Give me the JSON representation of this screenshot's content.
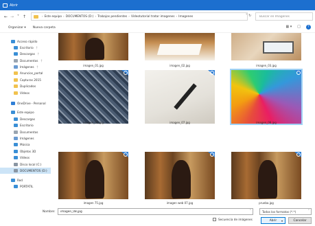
{
  "window": {
    "title": "Abrir"
  },
  "nav": {
    "back": "←",
    "forward": "→",
    "recent": "˅",
    "up": "↑"
  },
  "address": {
    "crumbs": [
      "Este equipo",
      "DOCUMENTOS (D:)",
      "Trabajos pendientes",
      "Videotutorial tratar imagenes",
      "Imagenes"
    ],
    "tools": "˅  ↻",
    "search_placeholder": "Buscar en Imagenes"
  },
  "toolbar": {
    "organize": "Organizar ▾",
    "new_folder": "Nueva carpeta",
    "view": "▦ ▾",
    "pane": "□",
    "help": "?"
  },
  "sidebar": {
    "items": [
      {
        "label": "Acceso rápido",
        "icon": "star-icon",
        "color": "#3a8fd6",
        "pinned": false
      },
      {
        "label": "Escritorio",
        "icon": "desktop-icon",
        "color": "#3a8fd6",
        "pinned": true
      },
      {
        "label": "Descargas",
        "icon": "download-icon",
        "color": "#3a8fd6",
        "pinned": true
      },
      {
        "label": "Documentos",
        "icon": "document-icon",
        "color": "#9aa5b1",
        "pinned": true
      },
      {
        "label": "Imágenes",
        "icon": "picture-icon",
        "color": "#6b9bd2",
        "pinned": true
      },
      {
        "label": "Anuncios_portal",
        "icon": "folder-icon",
        "color": "#f1c24e",
        "pinned": false
      },
      {
        "label": "Capturas 2015",
        "icon": "folder-icon",
        "color": "#f1c24e",
        "pinned": false
      },
      {
        "label": "Duplicados",
        "icon": "folder-icon",
        "color": "#f1c24e",
        "pinned": false
      },
      {
        "label": "Vídeos",
        "icon": "folder-icon",
        "color": "#f1c24e",
        "pinned": false
      },
      {
        "label": "OneDrive - Personal",
        "icon": "cloud-icon",
        "color": "#2f7fd6",
        "pinned": false
      },
      {
        "label": "Este equipo",
        "icon": "computer-icon",
        "color": "#3a8fd6",
        "pinned": false
      },
      {
        "label": "Descargas",
        "icon": "download-icon",
        "color": "#3a8fd6",
        "pinned": false
      },
      {
        "label": "Escritorio",
        "icon": "desktop-icon",
        "color": "#3a8fd6",
        "pinned": false
      },
      {
        "label": "Documentos",
        "icon": "document-icon",
        "color": "#9aa5b1",
        "pinned": false
      },
      {
        "label": "Imágenes",
        "icon": "picture-icon",
        "color": "#6b9bd2",
        "pinned": false
      },
      {
        "label": "Música",
        "icon": "music-icon",
        "color": "#3a8fd6",
        "pinned": false
      },
      {
        "label": "Objetos 3D",
        "icon": "cube-icon",
        "color": "#3a8fd6",
        "pinned": false
      },
      {
        "label": "Vídeos",
        "icon": "video-icon",
        "color": "#3a8fd6",
        "pinned": false
      },
      {
        "label": "Disco local (C:)",
        "icon": "drive-icon",
        "color": "#8a96a3",
        "pinned": false
      },
      {
        "label": "DOCUMENTOS (D:)",
        "icon": "drive-icon",
        "color": "#8a96a3",
        "pinned": false,
        "selected": true
      },
      {
        "label": "Red",
        "icon": "network-icon",
        "color": "#3a8fd6",
        "pinned": false
      },
      {
        "label": "PORTATIL",
        "icon": "computer-icon",
        "color": "#3a8fd6",
        "pinned": false
      }
    ]
  },
  "files": [
    {
      "name": "imagen_01.jpg",
      "photo": "library",
      "badge": false
    },
    {
      "name": "imagen_02.jpg",
      "photo": "reading",
      "badge": false
    },
    {
      "name": "imagen_03.jpg",
      "photo": "laptop",
      "badge": false
    },
    {
      "name": "imagen_05.jpg",
      "photo": "type",
      "badge": true
    },
    {
      "name": "imagen_07.jpg",
      "photo": "pen",
      "badge": true
    },
    {
      "name": "imagen_08.jpg",
      "photo": "pencils",
      "badge": true,
      "selected": true
    },
    {
      "name": "imagen 75.jpg",
      "photo": "library",
      "badge": true
    },
    {
      "name": "imagen web 07.jpg",
      "photo": "library",
      "badge": true
    },
    {
      "name": "prueba.jpg",
      "photo": "library",
      "badge": true
    }
  ],
  "bottom": {
    "name_label": "Nombre:",
    "name_value": "imagen_08.jpg",
    "filter_value": "Todos los formatos (*.*)",
    "sequence_label": "Secuencia de imágenes",
    "open_label": "Abrir",
    "open_split": "▾",
    "cancel_label": "Cancelar",
    "dropdown_caret": "˅"
  }
}
